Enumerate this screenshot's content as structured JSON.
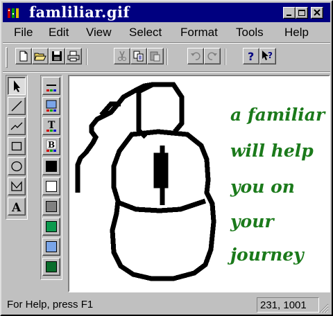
{
  "window": {
    "title": "famliliar.gif"
  },
  "menu": [
    "File",
    "Edit",
    "View",
    "Select",
    "Format",
    "Tools",
    "Help"
  ],
  "toolbar": {
    "buttons": [
      {
        "icon": "new-doc-icon"
      },
      {
        "icon": "open-folder-icon"
      },
      {
        "icon": "save-disk-icon"
      },
      {
        "icon": "print-icon"
      },
      {
        "icon": "cut-scissors-icon"
      },
      {
        "icon": "copy-icon"
      },
      {
        "icon": "paste-icon"
      },
      {
        "icon": "undo-icon"
      },
      {
        "icon": "redo-icon"
      },
      {
        "icon": "help-question-icon"
      },
      {
        "icon": "context-help-icon"
      }
    ]
  },
  "tools": [
    {
      "icon": "arrow-pointer-icon",
      "pressed": true
    },
    {
      "icon": "line-tool-icon"
    },
    {
      "icon": "polyline-tool-icon"
    },
    {
      "icon": "rectangle-tool-icon"
    },
    {
      "icon": "ellipse-tool-icon"
    },
    {
      "icon": "polygon-tool-icon"
    },
    {
      "icon": "text-tool-icon",
      "glyph": "A"
    }
  ],
  "palette": {
    "options": [
      {
        "icon": "line-color-icon",
        "glyph": ""
      },
      {
        "icon": "fill-color-icon",
        "glyph": ""
      },
      {
        "icon": "text-color-icon",
        "glyph": "T"
      },
      {
        "icon": "background-color-icon",
        "glyph": "B"
      }
    ],
    "colors": [
      "#000000",
      "#ffffff",
      "#808080",
      "#0c9a4e",
      "#7aa5e8",
      "#0a6e2c"
    ]
  },
  "canvas": {
    "caption": [
      "a familiar",
      "will help",
      "you on",
      "your",
      "journey"
    ],
    "caption_color": "#1b7a1b"
  },
  "status": {
    "help": "For Help, press F1",
    "coords": "231, 1001"
  }
}
